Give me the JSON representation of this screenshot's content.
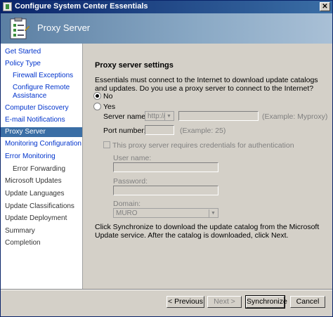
{
  "window": {
    "title": "Configure System Center Essentials"
  },
  "banner": {
    "title": "Proxy Server"
  },
  "sidebar": {
    "items": [
      {
        "label": "Get Started"
      },
      {
        "label": "Policy Type"
      },
      {
        "label": "Firewall Exceptions"
      },
      {
        "label": "Configure Remote Assistance"
      },
      {
        "label": "Computer Discovery"
      },
      {
        "label": "E-mail Notifications"
      },
      {
        "label": "Proxy Server"
      },
      {
        "label": "Monitoring Configuration"
      },
      {
        "label": "Error Monitoring"
      },
      {
        "label": "Error Forwarding"
      },
      {
        "label": "Microsoft Updates"
      },
      {
        "label": "Update Languages"
      },
      {
        "label": "Update Classifications"
      },
      {
        "label": "Update Deployment"
      },
      {
        "label": "Summary"
      },
      {
        "label": "Completion"
      }
    ]
  },
  "proxy": {
    "section_title": "Proxy server settings",
    "description": "Essentials must connect to the Internet to download update catalogs and updates. Do you use a proxy server to connect to the Internet?",
    "radio_no": "No",
    "radio_yes": "Yes",
    "server_name_label": "Server name:",
    "protocol_value": "http://",
    "server_example": "(Example: Myproxy)",
    "port_label": "Port number:",
    "port_example": "(Example: 25)",
    "credentials_label": "This proxy server requires credentials for authentication",
    "username_label": "User name:",
    "password_label": "Password:",
    "domain_label": "Domain:",
    "domain_value": "MURO",
    "sync_text": "Click Synchronize to download the update catalog from the Microsoft Update service. After the catalog is downloaded, click Next."
  },
  "buttons": {
    "previous": "< Previous",
    "next": "Next >",
    "synchronize": "Synchronize",
    "cancel": "Cancel"
  }
}
